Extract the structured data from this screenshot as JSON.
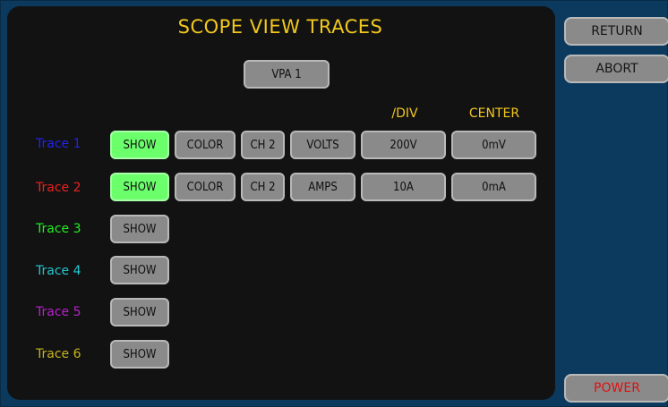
{
  "title": "SCOPE VIEW TRACES",
  "source_button": "VPA 1",
  "columns": {
    "per_div": "/DIV",
    "center": "CENTER"
  },
  "traces": [
    {
      "label": "Trace 1",
      "color": "#2222ee",
      "show": "SHOW",
      "show_on": true,
      "color_btn": "COLOR",
      "channel": "CH 2",
      "unit": "VOLTS",
      "per_div": "200V",
      "center": "0mV"
    },
    {
      "label": "Trace 2",
      "color": "#ee2020",
      "show": "SHOW",
      "show_on": true,
      "color_btn": "COLOR",
      "channel": "CH 2",
      "unit": "AMPS",
      "per_div": "10A",
      "center": "0mA"
    },
    {
      "label": "Trace 3",
      "color": "#22ee22",
      "show": "SHOW",
      "show_on": false
    },
    {
      "label": "Trace 4",
      "color": "#22c8d2",
      "show": "SHOW",
      "show_on": false
    },
    {
      "label": "Trace 5",
      "color": "#b422c8",
      "show": "SHOW",
      "show_on": false
    },
    {
      "label": "Trace 6",
      "color": "#c8b41e",
      "show": "SHOW",
      "show_on": false
    }
  ],
  "side": {
    "return": "RETURN",
    "abort": "ABORT",
    "power": "POWER",
    "power_color": "#e01010"
  }
}
